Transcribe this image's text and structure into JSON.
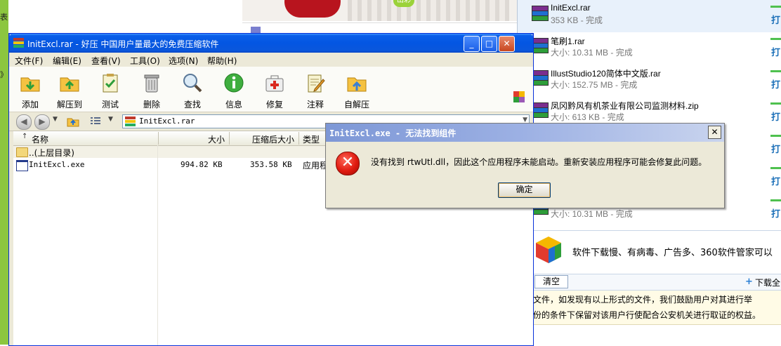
{
  "background": {
    "left_strip_top": "表",
    "left_strip_bottom": "》",
    "banner_bubble": "出彩"
  },
  "download_panel": {
    "items": [
      {
        "name": "InitExcl.rar",
        "info": "353 KB - 完成",
        "action": "打"
      },
      {
        "name": "笔刷1.rar",
        "info": "大小: 10.31 MB - 完成",
        "action": "打"
      },
      {
        "name": "IllustStudio120简体中文版.rar",
        "info": "大小: 152.75 MB - 完成",
        "action": "打"
      },
      {
        "name": "凤冈黔风有机茶业有限公司监测材料.zip",
        "info": "大小: 613 KB - 完成",
        "action": "打"
      },
      {
        "name": "",
        "info": "",
        "action": "打"
      },
      {
        "name": "",
        "info": "",
        "action": "打"
      },
      {
        "name": "",
        "info": "大小: 10.31 MB - 完成",
        "action": "打"
      }
    ],
    "ad_text": "软件下载慢、有病毒、广告多、360软件管家可以",
    "clear_label": "清空",
    "download_all_label": "下载全",
    "notice_line1": "文件，如发现有以上形式的文件，我们鼓励用户对其进行举",
    "notice_line2": "份的条件下保留对该用户行使配合公安机关进行取证的权益。"
  },
  "haozip": {
    "title": "InitExcl.rar - 好压  中国用户量最大的免费压缩软件",
    "window_buttons": {
      "minimize": "_",
      "maximize": "□",
      "close": "✕"
    },
    "menu": [
      "文件(F)",
      "编辑(E)",
      "查看(V)",
      "工具(O)",
      "选项(N)",
      "帮助(H)"
    ],
    "toolbar": [
      {
        "label": "添加",
        "icon": "add-icon"
      },
      {
        "label": "解压到",
        "icon": "extract-icon"
      },
      {
        "label": "测试",
        "icon": "test-icon"
      },
      {
        "label": "删除",
        "icon": "delete-icon"
      },
      {
        "label": "查找",
        "icon": "search-icon"
      },
      {
        "label": "信息",
        "icon": "info-icon"
      },
      {
        "label": "修复",
        "icon": "repair-icon"
      },
      {
        "label": "注释",
        "icon": "comment-icon"
      },
      {
        "label": "自解压",
        "icon": "sfx-icon"
      }
    ],
    "address": "InitExcl.rar",
    "columns": {
      "name": "名称",
      "size": "大小",
      "packed": "压缩后大小",
      "type": "类型"
    },
    "parent_row": "..(上层目录)",
    "files": [
      {
        "name": "InitExcl.exe",
        "size": "994.82 KB",
        "packed": "353.58 KB",
        "type": "应用程序"
      }
    ]
  },
  "dialog": {
    "title": "InitExcl.exe - 无法找到组件",
    "message": "没有找到 rtwUtl.dll，因此这个应用程序未能启动。重新安装应用程序可能会修复此问题。",
    "ok_label": "确定",
    "close_label": "✕",
    "error_glyph": "✕"
  },
  "colors": {
    "titlebar": "#0456e2",
    "dialog_title": "#7d97d6",
    "error_red": "#e01b10",
    "dl_bar": "#4fc14f",
    "link_blue": "#1b6fb8"
  }
}
